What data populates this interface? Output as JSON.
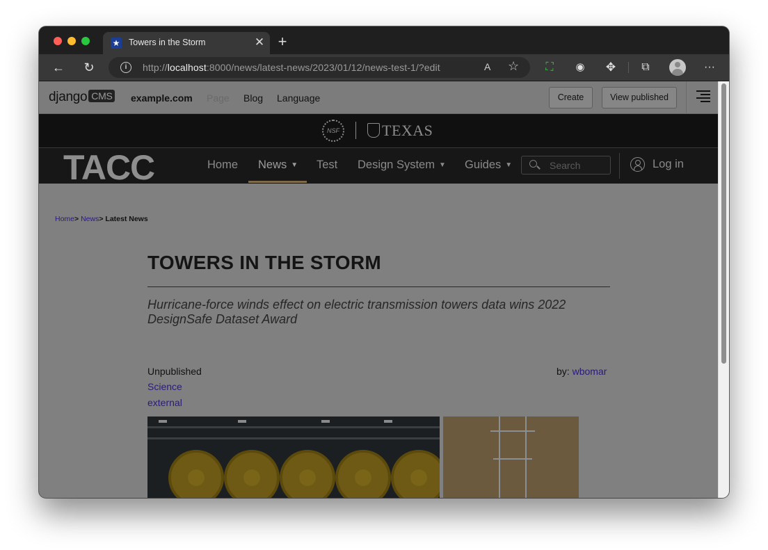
{
  "browser": {
    "tab_title": "Towers in the Storm",
    "tab_close": "✕",
    "new_tab": "+",
    "url_prefix": "http://",
    "url_host": "localhost",
    "url_rest": ":8000/news/latest-news/2023/01/12/news-test-1/?edit",
    "back": "←",
    "reload": "↻",
    "read_aloud": "A",
    "favorite_add": "☆",
    "more": "···"
  },
  "cms_toolbar": {
    "logo_text": "django",
    "logo_box": "CMS",
    "site": "example.com",
    "page": "Page",
    "blog": "Blog",
    "language": "Language",
    "create": "Create",
    "view_published": "View published"
  },
  "logo_bar": {
    "nsf": "NSF",
    "texas": "TEXAS"
  },
  "nav": {
    "logo": "TACC",
    "home": "Home",
    "news": "News",
    "test": "Test",
    "design_system": "Design System",
    "guides": "Guides",
    "search_placeholder": "Search",
    "login": "Log in"
  },
  "breadcrumb": {
    "home": "Home",
    "news": "News",
    "sep": ">",
    "current": "Latest News"
  },
  "article": {
    "title": "TOWERS IN THE STORM",
    "subtitle": "Hurricane-force winds effect on electric transmission towers data wins 2022 DesignSafe Dataset Award",
    "status": "Unpublished",
    "by_label": "by:",
    "author": "wbomar",
    "categories": [
      "Science",
      "external"
    ]
  }
}
